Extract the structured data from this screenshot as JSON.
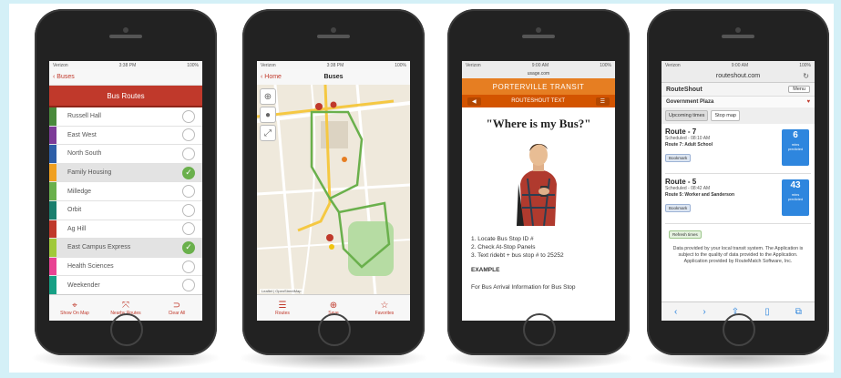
{
  "phone1": {
    "status": {
      "carrier": "Verizon",
      "time": "3:38 PM",
      "battery": "100%"
    },
    "nav_back": "Buses",
    "title": "Bus Routes",
    "routes": [
      {
        "name": "Russell Hall",
        "color": "#4a8a3c",
        "selected": false
      },
      {
        "name": "East West",
        "color": "#7d3c98",
        "selected": false
      },
      {
        "name": "North South",
        "color": "#2e5fa8",
        "selected": false
      },
      {
        "name": "Family Housing",
        "color": "#f0a020",
        "selected": true
      },
      {
        "name": "Milledge",
        "color": "#6ab04c",
        "selected": false
      },
      {
        "name": "Orbit",
        "color": "#1a7f6e",
        "selected": false
      },
      {
        "name": "Ag Hill",
        "color": "#c0392b",
        "selected": false
      },
      {
        "name": "East Campus Express",
        "color": "#a0c93a",
        "selected": true
      },
      {
        "name": "Health Sciences",
        "color": "#e84393",
        "selected": false
      },
      {
        "name": "Weekender",
        "color": "#16a085",
        "selected": false
      }
    ],
    "tabs": [
      {
        "label": "Show On Map",
        "icon": "map-icon"
      },
      {
        "label": "Nearby Routes",
        "icon": "nearby-icon"
      },
      {
        "label": "Clear All",
        "icon": "clear-icon"
      }
    ]
  },
  "phone2": {
    "status": {
      "carrier": "Verizon",
      "time": "3:38 PM",
      "battery": "100%"
    },
    "nav_back": "Home",
    "title": "Buses",
    "map_credit": "Leaflet | OpenStreetMap",
    "tabs": [
      {
        "label": "Routes",
        "icon": "list-icon"
      },
      {
        "label": "Save",
        "icon": "plus-icon"
      },
      {
        "label": "Favorites",
        "icon": "star-icon"
      }
    ]
  },
  "phone3": {
    "status": {
      "carrier": "Verizon",
      "time": "9:00 AM",
      "battery": "100%"
    },
    "url": "usage.com",
    "banner": "PORTERVILLE TRANSIT",
    "sub_banner": "ROUTESHOUT TEXT",
    "headline": "\"Where is my Bus?\"",
    "steps": [
      "1. Locate Bus Stop ID #",
      "2. Check At-Stop Panels",
      "3. Text ridebt + bus stop # to 25252"
    ],
    "example_label": "EXAMPLE",
    "footer": "For Bus Arrival Information for Bus Stop"
  },
  "phone4": {
    "status": {
      "carrier": "Verizon",
      "time": "9:00 AM",
      "battery": "100%"
    },
    "url": "routeshout.com",
    "brand": "RouteShout",
    "menu_label": "Menu",
    "place": "Government Plaza",
    "tabs": [
      "Upcoming times",
      "Stop map"
    ],
    "cards": [
      {
        "route": "Route - 7",
        "scheduled": "Scheduled - 08:10 AM",
        "detail": "Route 7: Adult School",
        "chip": "Bookmark",
        "big": "6",
        "unit": "mins",
        "label": "predicted"
      },
      {
        "route": "Route - 5",
        "scheduled": "Scheduled - 08:42 AM",
        "detail": "Route 5: Worker and Sanderson",
        "chip": "Bookmark",
        "big": "43",
        "unit": "mins",
        "label": "predicted"
      }
    ],
    "chip2": "Refresh times",
    "footer": "Data provided by your local transit system. The Application is subject to the quality of data provided to the Application. Application provided by RouteMatch Software, Inc."
  }
}
